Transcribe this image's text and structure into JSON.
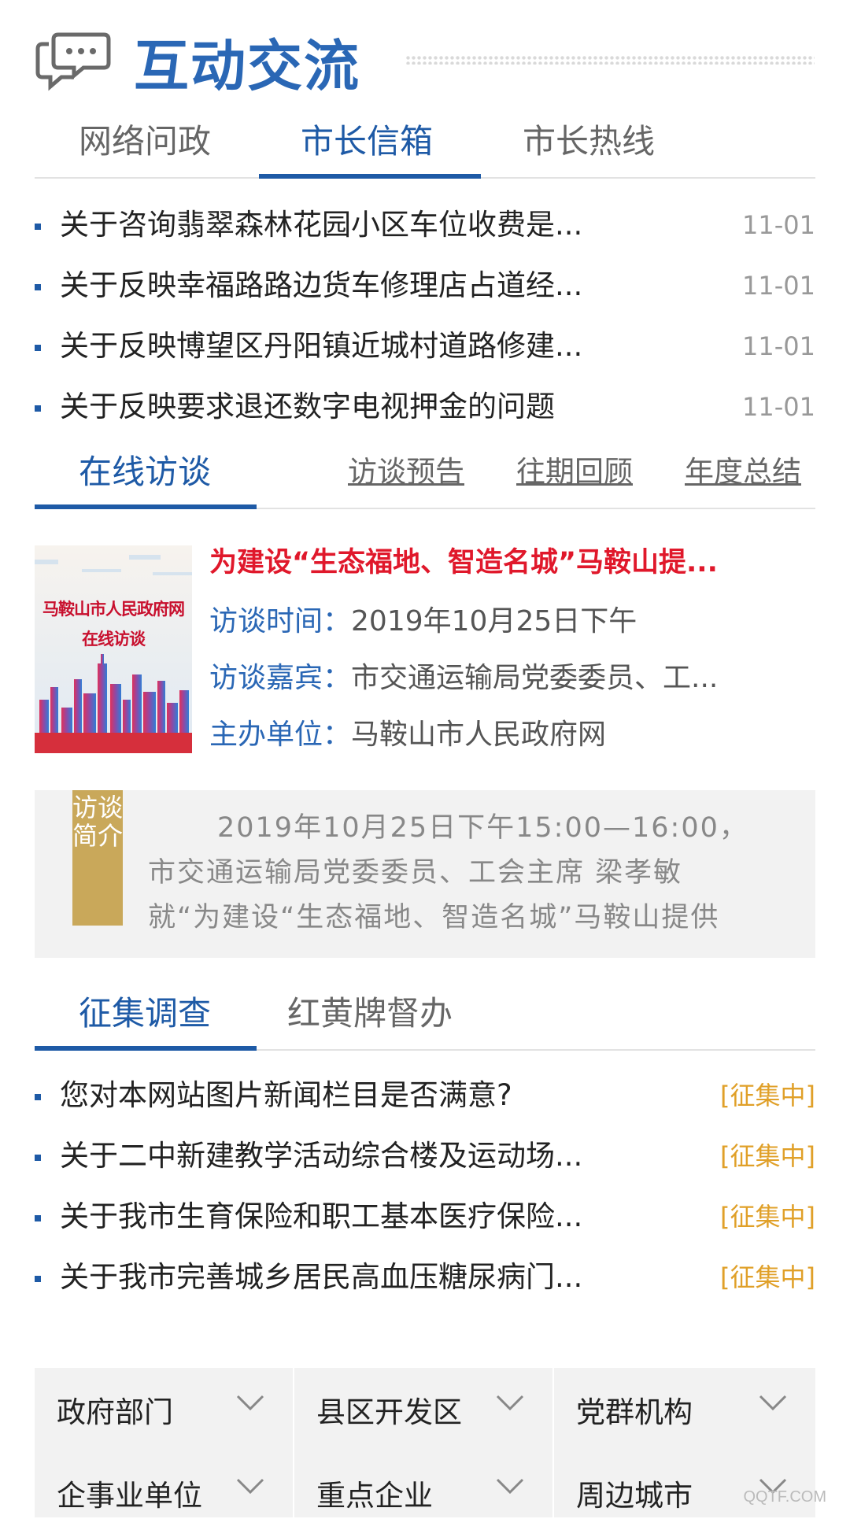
{
  "header": {
    "title": "互动交流"
  },
  "tabs1": {
    "items": [
      {
        "label": "网络问政"
      },
      {
        "label": "市长信箱"
      },
      {
        "label": "市长热线"
      }
    ],
    "active_index": 1
  },
  "mailbox_list": [
    {
      "title": "关于咨询翡翠森林花园小区车位收费是...",
      "date": "11-01"
    },
    {
      "title": "关于反映幸福路路边货车修理店占道经...",
      "date": "11-01"
    },
    {
      "title": "关于反映博望区丹阳镇近城村道路修建...",
      "date": "11-01"
    },
    {
      "title": "关于反映要求退还数字电视押金的问题",
      "date": "11-01"
    }
  ],
  "interview": {
    "tab_label": "在线访谈",
    "links": [
      "访谈预告",
      "往期回顾",
      "年度总结"
    ],
    "thumb": {
      "line1": "马鞍山市人民政府网",
      "line2": "在线访谈"
    },
    "title": "为建设“生态福地、智造名城”马鞍山提...",
    "time_label": "访谈时间：",
    "time_value": "2019年10月25日下午",
    "guest_label": "访谈嘉宾：",
    "guest_value": "市交通运输局党委委员、工...",
    "host_label": "主办单位：",
    "host_value": "马鞍山市人民政府网"
  },
  "intro": {
    "ribbon": "访谈简介",
    "line1": "2019年10月25日下午15:00—16:00，",
    "line2": "市交通运输局党委委员、工会主席 梁孝敏",
    "line3": "就“为建设“生态福地、智造名城”马鞍山提供"
  },
  "tabs2": {
    "items": [
      {
        "label": "征集调查"
      },
      {
        "label": "红黄牌督办"
      }
    ],
    "active_index": 0
  },
  "survey_list": [
    {
      "title": "您对本网站图片新闻栏目是否满意?",
      "status": "[征集中]"
    },
    {
      "title": "关于二中新建教学活动综合楼及运动场...",
      "status": "[征集中]"
    },
    {
      "title": "关于我市生育保险和职工基本医疗保险...",
      "status": "[征集中]"
    },
    {
      "title": "关于我市完善城乡居民高血压糖尿病门...",
      "status": "[征集中]"
    }
  ],
  "links_grid": [
    {
      "label": "政府部门"
    },
    {
      "label": "县区开发区"
    },
    {
      "label": "党群机构"
    },
    {
      "label": "企事业单位"
    },
    {
      "label": "重点企业"
    },
    {
      "label": "周边城市"
    }
  ],
  "watermark": "QQTF.COM",
  "colors": {
    "accent": "#1e5aa6",
    "title_red": "#e0182b",
    "status_orange": "#e0a029",
    "ribbon_gold": "#c9a85a"
  }
}
